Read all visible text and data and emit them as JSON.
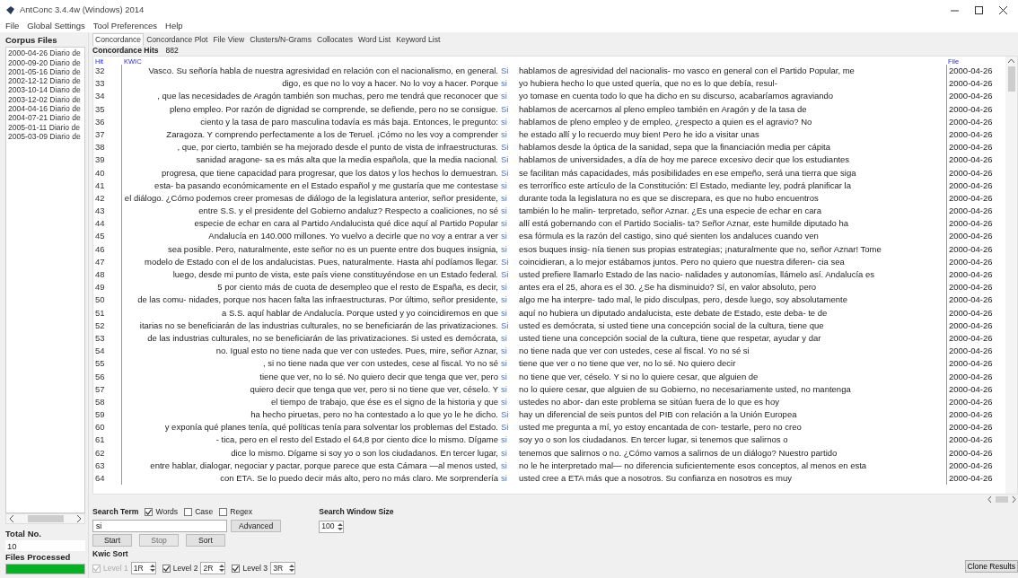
{
  "window": {
    "title": "AntConc 3.4.4w (Windows) 2014"
  },
  "menu": [
    "File",
    "Global Settings",
    "Tool Preferences",
    "Help"
  ],
  "corpus_files": {
    "heading": "Corpus Files",
    "items": [
      "2000-04-26 Diario de",
      "2000-09-20 Diario de",
      "2001-05-16 Diario de",
      "2002-12-12 Diario de",
      "2003-10-14 Diario de",
      "2003-12-02 Diario de",
      "2004-04-16 Diario de",
      "2004-07-21 Diario de",
      "2005-01-11 Diario de",
      "2005-03-09 Diario de"
    ],
    "total_label": "Total No.",
    "total": "10",
    "processed_label": "Files Processed",
    "level": 1
  },
  "tabs": [
    {
      "label": "Concordance",
      "selected": true
    },
    {
      "label": "Concordance Plot",
      "selected": false
    },
    {
      "label": "File View",
      "selected": false
    },
    {
      "label": "Clusters/N-Grams",
      "selected": false
    },
    {
      "label": "Collocates",
      "selected": false
    },
    {
      "label": "Word List",
      "selected": false
    },
    {
      "label": "Keyword List",
      "selected": false
    }
  ],
  "hits": {
    "label": "Concordance Hits",
    "count": "882"
  },
  "table": {
    "columns": [
      "Hit",
      "KWIC",
      "File"
    ],
    "rows": [
      {
        "hit": "32",
        "left": "Vasco. Su señoría habla de nuestra agresividad en relación con el nacionalismo, en general.",
        "keyword": "Si",
        "right": "hablamos de agresividad del nacionalis- mo vasco en general con el Partido Popular, me",
        "file": "2000-04-26"
      },
      {
        "hit": "33",
        "left": "digo, es que no lo voy a hacer. No lo voy a hacer. Porque",
        "keyword": "si",
        "right": "yo hubiera hecho lo que usted quería, que no es lo que debía, resul-",
        "file": "2000-04-26"
      },
      {
        "hit": "34",
        "left": ", que las necesidades de Aragón también son muchas, pero me tendrá que reconocer que",
        "keyword": "si",
        "right": "yo tomase en cuenta todo lo que ha dicho en su discurso, acabaríamos agraviando",
        "file": "2000-04-26"
      },
      {
        "hit": "35",
        "left": "pleno empleo. Por razón de dignidad se comprende, se defiende, pero no se consigue.",
        "keyword": "Si",
        "right": "hablamos de acercarnos al pleno empleo también en Aragón y de la tasa de",
        "file": "2000-04-26"
      },
      {
        "hit": "36",
        "left": "ciento y la tasa de paro masculina todavía es más baja. Entonces, le pregunto:",
        "keyword": "si",
        "right": "hablamos de pleno empleo y de empleo, ¿respecto a quien es el agravio? No",
        "file": "2000-04-26"
      },
      {
        "hit": "37",
        "left": "Zaragoza. Y comprendo perfectamente a los de Teruel. ¡Cómo no les voy a comprender",
        "keyword": "si",
        "right": "he estado allí y lo recuerdo muy bien! Pero he ido a visitar unas",
        "file": "2000-04-26"
      },
      {
        "hit": "38",
        "left": ", que, por cierto, también se ha mejorado desde el punto de vista de infraestructuras.",
        "keyword": "Si",
        "right": "hablamos desde la óptica de la sanidad, sepa que la financiación media per cápita",
        "file": "2000-04-26"
      },
      {
        "hit": "39",
        "left": "sanidad aragone- sa es más alta que la media española, que la media nacional.",
        "keyword": "Si",
        "right": "hablamos de universidades, a día de hoy me parece excesivo decir que los estudiantes",
        "file": "2000-04-26"
      },
      {
        "hit": "40",
        "left": "progresa, que tiene capacidad para progresar, que los datos y los hechos lo demuestran.",
        "keyword": "Si",
        "right": "se facilitan más capacidades, más posibilidades en ese empeño, será una tierra que siga",
        "file": "2000-04-26"
      },
      {
        "hit": "41",
        "left": "esta- ba pasando económicamente en el Estado español y me gustaría que me contestase",
        "keyword": "si",
        "right": "es terrorífico este artículo de la Constitución: El Estado, mediante ley, podrá planificar la",
        "file": "2000-04-26"
      },
      {
        "hit": "42",
        "left": "el diálogo. ¿Cómo podemos creer promesas de diálogo de la legislatura anterior, señor presidente,",
        "keyword": "si",
        "right": "durante toda la legislatura no es que se discrepara, es que no hubo encuentros",
        "file": "2000-04-26"
      },
      {
        "hit": "43",
        "left": "entre S.S. y el presidente del Gobierno andaluz?  Respecto a coaliciones, no sé",
        "keyword": "si",
        "right": "también lo he malin- terpretado, señor Aznar. ¿Es una especie de echar en cara",
        "file": "2000-04-26"
      },
      {
        "hit": "44",
        "left": "especie de echar en cara al Partido Andalucista qué dice aquí al Partido Popular",
        "keyword": "si",
        "right": "allí está gobernando con el Partido Socialis- ta? Señor Aznar, este humilde diputado ha",
        "file": "2000-04-26"
      },
      {
        "hit": "45",
        "left": "Andalucía en 140.000 millones. Yo vuelvo a decirle que no voy a entrar a ver",
        "keyword": "si",
        "right": "esa fórmula es la razón del castigo, sino qué sienten los andaluces cuando ven",
        "file": "2000-04-26"
      },
      {
        "hit": "46",
        "left": "sea posible. Pero, naturalmente, este señor no es un puente entre dos buques insignia,",
        "keyword": "si",
        "right": "esos buques insig- nía tienen sus propias estrategias; ¡naturalmente que no, señor Aznar! Tome",
        "file": "2000-04-26"
      },
      {
        "hit": "47",
        "left": "modelo de Estado con el de los andalucistas. Pues, naturalmente. Hasta ahí podíamos llegar.",
        "keyword": "Si",
        "right": "coincidieran, a lo mejor estábamos juntos. Pero no quiero que nuestra diferen- cia sea",
        "file": "2000-04-26"
      },
      {
        "hit": "48",
        "left": "luego, desde mi punto de vista, este país viene constituyéndose en un Estado federal.",
        "keyword": "Si",
        "right": "usted prefiere llamarlo Estado de las nacio- nalidades y autonomías, llámelo así. Andalucía es",
        "file": "2000-04-26"
      },
      {
        "hit": "49",
        "left": "5 por ciento más de cuota de desempleo que el resto de España, es decir,",
        "keyword": "si",
        "right": "antes era el 25, ahora es el 30. ¿Se ha disminuido? Sí, en valor absoluto, pero",
        "file": "2000-04-26"
      },
      {
        "hit": "50",
        "left": "de las comu- nidades, porque nos hacen falta las infraestructuras.  Por último, señor presidente,",
        "keyword": "si",
        "right": "algo me ha interpre- tado mal, le pido disculpas, pero, desde luego, soy absolutamente",
        "file": "2000-04-26"
      },
      {
        "hit": "51",
        "left": "a S.S. aquí hablar de Andalucía. Porque usted y yo coincidiremos en que",
        "keyword": "si",
        "right": "aquí no hubiera un diputado andalucista, este debate de Estado, este deba- te de",
        "file": "2000-04-26"
      },
      {
        "hit": "52",
        "left": "itarias no se beneficiarán de las industrias culturales, no se beneficiarán de las privatizaciones.",
        "keyword": "Si",
        "right": "usted es demócrata, si usted tiene una concepción social de la cultura, tiene que",
        "file": "2000-04-26"
      },
      {
        "hit": "53",
        "left": "de las industrias culturales, no se beneficiarán de las privatizaciones. Si usted es demócrata,",
        "keyword": "si",
        "right": "usted tiene una concepción social de la cultura, tiene que respetar, ayudar y dar",
        "file": "2000-04-26"
      },
      {
        "hit": "54",
        "left": "no. Igual esto no tiene nada que ver con ustedes. Pues, mire, señor Aznar,",
        "keyword": "si",
        "right": "no tiene nada que ver con ustedes, cese al fiscal. Yo no sé si",
        "file": "2000-04-26"
      },
      {
        "hit": "55",
        "left": ", si no tiene nada que ver con ustedes, cese al fiscal. Yo no sé",
        "keyword": "si",
        "right": "tiene que ver o no tiene que ver, no lo sé. No quiero decir",
        "file": "2000-04-26"
      },
      {
        "hit": "56",
        "left": "tiene que ver, no lo sé. No quiero decir que tenga que ver, pero",
        "keyword": "si",
        "right": "no tiene que ver, céselo. Y si no lo quiere cesar, que alguien de",
        "file": "2000-04-26"
      },
      {
        "hit": "57",
        "left": "quiero decir que tenga que ver, pero si no tiene que ver, céselo. Y",
        "keyword": "si",
        "right": "no lo quiere cesar, que alguien de su Gobierno, no necesariamente usted, no mantenga",
        "file": "2000-04-26"
      },
      {
        "hit": "58",
        "left": "el tiempo de trabajo, que ése es el signo de la historia y que",
        "keyword": "si",
        "right": "ustedes no abor- dan este problema se sitúan fuera de lo que es hoy",
        "file": "2000-04-26"
      },
      {
        "hit": "59",
        "left": "ha hecho piruetas, pero no ha contestado a lo que yo le he dicho.",
        "keyword": "Si",
        "right": "hay un diferencial de seis puntos del PIB con relación a la Unión Europea",
        "file": "2000-04-26"
      },
      {
        "hit": "60",
        "left": "y exponía qué planes tenía, qué políticas tenía para solventar los problemas del Estado.",
        "keyword": "Si",
        "right": "usted me pregunta a mí, yo estoy encantada de con- testarle, pero no creo",
        "file": "2000-04-26"
      },
      {
        "hit": "61",
        "left": "- tica, pero en el resto del Estado el 64,8 por ciento dice lo mismo. Dígame",
        "keyword": "si",
        "right": "soy yo o son los ciudadanos.  En tercer lugar, si tenemos que salirnos o",
        "file": "2000-04-26"
      },
      {
        "hit": "62",
        "left": "dice lo mismo. Dígame si soy yo o son los ciudadanos.  En tercer lugar,",
        "keyword": "si",
        "right": "tenemos que salirnos o no. ¿Cómo vamos a salirnos de un diálogo? Nuestro partido",
        "file": "2000-04-26"
      },
      {
        "hit": "63",
        "left": "entre hablar, dialogar, negociar y pactar, porque parece que esta Cámara —al menos usted,",
        "keyword": "si",
        "right": "no le he interpretado mal— no diferencia suficientemente esos conceptos, al menos en esta",
        "file": "2000-04-26"
      },
      {
        "hit": "64",
        "left": "con ETA. Se lo puedo decir más alto, pero no más claro. Me sorprendería",
        "keyword": "si",
        "right": "usted cree a ETA más que a nosotros. Su confianza en nosotros es muy",
        "file": "2000-04-26"
      }
    ]
  },
  "search": {
    "label": "Search Term",
    "options": [
      {
        "label": "Words",
        "checked": true
      },
      {
        "label": "Case",
        "checked": false
      },
      {
        "label": "Regex",
        "checked": false
      }
    ],
    "value": "si",
    "advanced": "Advanced",
    "window_size_label": "Search Window Size",
    "window_size": "100"
  },
  "actions": [
    {
      "label": "Start",
      "disabled": false
    },
    {
      "label": "Stop",
      "disabled": true
    },
    {
      "label": "Sort",
      "disabled": false
    }
  ],
  "kwic_sort": {
    "label": "Kwic Sort",
    "levels": [
      {
        "label": "Level 1",
        "checked": true,
        "disabled": true,
        "value": "1R"
      },
      {
        "label": "Level 2",
        "checked": true,
        "disabled": false,
        "value": "2R"
      },
      {
        "label": "Level 3",
        "checked": true,
        "disabled": false,
        "value": "3R"
      }
    ]
  },
  "clone_button": "Clone Results"
}
